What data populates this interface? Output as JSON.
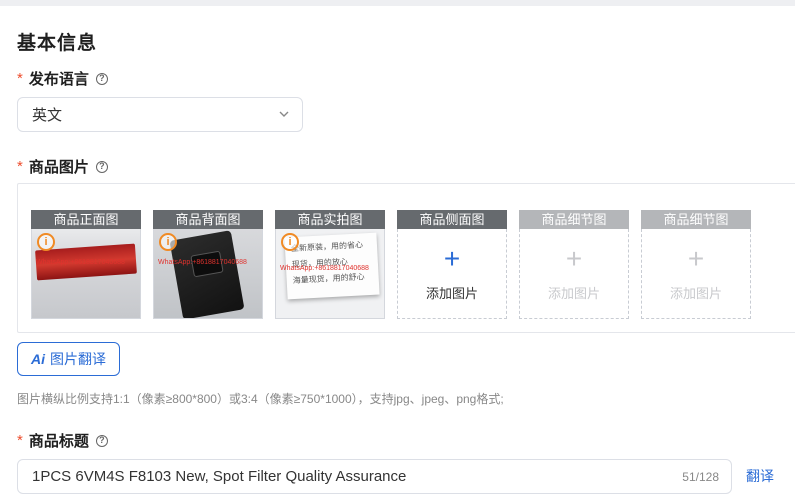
{
  "section": {
    "title": "基本信息"
  },
  "language_field": {
    "required_mark": "*",
    "label": "发布语言",
    "help_icon": "question-circle-icon",
    "selected_value": "英文",
    "dropdown_icon": "chevron-down-icon"
  },
  "image_field": {
    "required_mark": "*",
    "label": "商品图片",
    "help_icon": "question-circle-icon",
    "tiles": [
      {
        "caption": "商品正面图",
        "state": "uploaded",
        "watermark": "WhatsApp:+8618817040688"
      },
      {
        "caption": "商品背面图",
        "state": "uploaded",
        "watermark": "WhatsApp:+8618817040688"
      },
      {
        "caption": "商品实拍图",
        "state": "uploaded",
        "watermark": "WhatsApp:+8618817040688",
        "photo_lines": [
          "全新原装，用的省心",
          "现货，用的放心",
          "海量现货，用的舒心"
        ]
      },
      {
        "caption": "商品侧面图",
        "state": "add",
        "add_label": "添加图片"
      },
      {
        "caption": "商品细节图",
        "state": "disabled",
        "add_label": "添加图片"
      },
      {
        "caption": "商品细节图",
        "state": "disabled",
        "add_label": "添加图片"
      }
    ],
    "ai_translate_button": {
      "icon_text": "Ai",
      "label": "图片翻译"
    },
    "hint": "图片横纵比例支持1:1（像素≥800*800）或3:4（像素≥750*1000），支持jpg、jpeg、png格式;"
  },
  "title_field": {
    "required_mark": "*",
    "label": "商品标题",
    "help_icon": "question-circle-icon",
    "value": "1PCS 6VM4S F8103 New, Spot Filter Quality Assurance",
    "counter": "51/128",
    "translate_link": "翻译"
  },
  "colors": {
    "accent": "#2b6cd6",
    "required": "#ee4d2d",
    "warning": "#f08a24"
  }
}
